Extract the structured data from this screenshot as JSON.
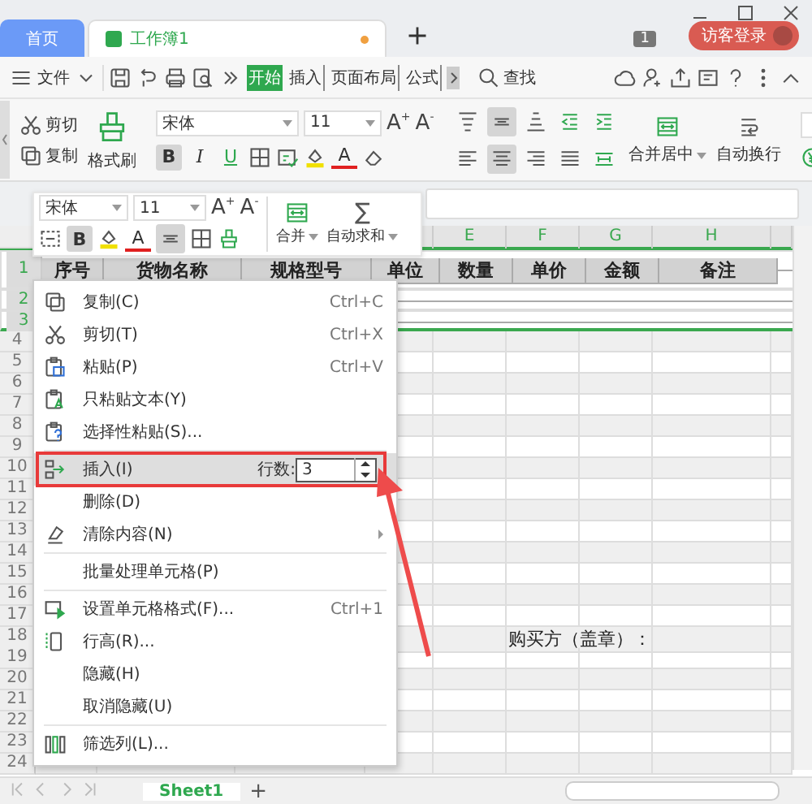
{
  "window": {
    "doc_tabs": [
      {
        "label": "首页",
        "selected": false,
        "modified": false
      },
      {
        "label": "工作簿1",
        "selected": true,
        "modified": true
      }
    ],
    "counter": "1",
    "login": "访客登录"
  },
  "menu_bar": {
    "file": "文件",
    "tabs": [
      {
        "label": "开始",
        "selected": true
      },
      {
        "label": "插入",
        "selected": false
      },
      {
        "label": "页面布局",
        "selected": false
      },
      {
        "label": "公式",
        "selected": false
      }
    ],
    "find": "查找"
  },
  "ribbon": {
    "clipboard": [
      "剪切",
      "复制"
    ],
    "format_painter": "格式刷",
    "font": "宋体",
    "size": "11",
    "grow_font": "A$^{+}$",
    "shrink_font": "A$^{-}$",
    "styles": [
      {
        "label": "B",
        "selected": true
      },
      {
        "label": "I",
        "selected": false
      },
      {
        "label": "U",
        "selected": false
      }
    ],
    "font_color": "A",
    "align_top": [
      {
        "selected": false
      },
      {
        "selected": true
      },
      {
        "selected": false
      },
      {
        "selected": false
      },
      {
        "selected": false
      }
    ],
    "align_bottom": [
      {
        "selected": false
      },
      {
        "selected": true
      },
      {
        "selected": false
      },
      {
        "selected": false
      },
      {
        "selected": false
      }
    ],
    "merge": "合并居中",
    "wrap": "自动换行"
  },
  "mini_toolbar": {
    "font": "宋体",
    "size": "11",
    "grow_font": "A$^{+}$",
    "shrink_font": "A$^{-}$",
    "bold": {
      "label": "B",
      "selected": true
    },
    "font_color": "A",
    "align_selected": true,
    "merge": "合并",
    "sum_symbol": "∑",
    "sum": "自动求和"
  },
  "sheet": {
    "columns": [
      "E",
      "F",
      "G",
      "H"
    ],
    "rows": [
      {
        "number": "1",
        "selected": true,
        "cells": [
          "序号",
          "货物名称",
          "规格型号",
          "单位",
          "数量",
          "单价",
          "金额",
          "备注"
        ]
      },
      {
        "number": "2",
        "selected": true
      },
      {
        "number": "3",
        "selected": true
      },
      {
        "number": "4",
        "selected": false
      },
      {
        "number": "5",
        "selected": false
      },
      {
        "number": "6",
        "selected": false
      },
      {
        "number": "7",
        "selected": false
      },
      {
        "number": "8",
        "selected": false
      },
      {
        "number": "9",
        "selected": false
      },
      {
        "number": "10",
        "selected": false
      },
      {
        "number": "11",
        "selected": false
      },
      {
        "number": "12",
        "selected": false
      },
      {
        "number": "13",
        "selected": false
      },
      {
        "number": "14",
        "selected": false
      },
      {
        "number": "15",
        "selected": false
      },
      {
        "number": "16",
        "selected": false
      },
      {
        "number": "17",
        "selected": false
      },
      {
        "number": "18",
        "selected": false,
        "cells": [
          null,
          null,
          null,
          null,
          null,
          "购买方（盖章）："
        ]
      },
      {
        "number": "19",
        "selected": false
      },
      {
        "number": "20",
        "selected": false
      },
      {
        "number": "21",
        "selected": false
      },
      {
        "number": "22",
        "selected": false
      },
      {
        "number": "23",
        "selected": false
      },
      {
        "number": "24",
        "selected": false
      }
    ],
    "sheet_tabs": [
      {
        "label": "Sheet1",
        "selected": true
      }
    ],
    "add_sheet": "+"
  },
  "context_menu": [
    {
      "kind": "item",
      "label": "复制(C)",
      "shortcut": "Ctrl+C",
      "selected": false
    },
    {
      "kind": "item",
      "label": "剪切(T)",
      "shortcut": "Ctrl+X",
      "selected": false
    },
    {
      "kind": "item",
      "label": "粘贴(P)",
      "shortcut": "Ctrl+V",
      "selected": false
    },
    {
      "kind": "item",
      "label": "只粘贴文本(Y)",
      "selected": false
    },
    {
      "kind": "item",
      "label": "选择性粘贴(S)...",
      "selected": false
    },
    {
      "kind": "separator"
    },
    {
      "kind": "row-count",
      "label": "插入(I)",
      "count_label": "行数:",
      "count": "3",
      "selected": true
    },
    {
      "kind": "item",
      "label": "删除(D)",
      "selected": false
    },
    {
      "kind": "submenu",
      "label": "清除内容(N)",
      "selected": false
    },
    {
      "kind": "separator"
    },
    {
      "kind": "item",
      "label": "批量处理单元格(P)",
      "selected": false
    },
    {
      "kind": "separator"
    },
    {
      "kind": "item",
      "label": "设置单元格格式(F)...",
      "shortcut": "Ctrl+1",
      "selected": false
    },
    {
      "kind": "item",
      "label": "行高(R)...",
      "selected": false
    },
    {
      "kind": "item",
      "label": "隐藏(H)",
      "selected": false
    },
    {
      "kind": "item",
      "label": "取消隐藏(U)",
      "selected": false
    },
    {
      "kind": "separator"
    },
    {
      "kind": "item",
      "label": "筛选列(L)...",
      "selected": false
    }
  ]
}
